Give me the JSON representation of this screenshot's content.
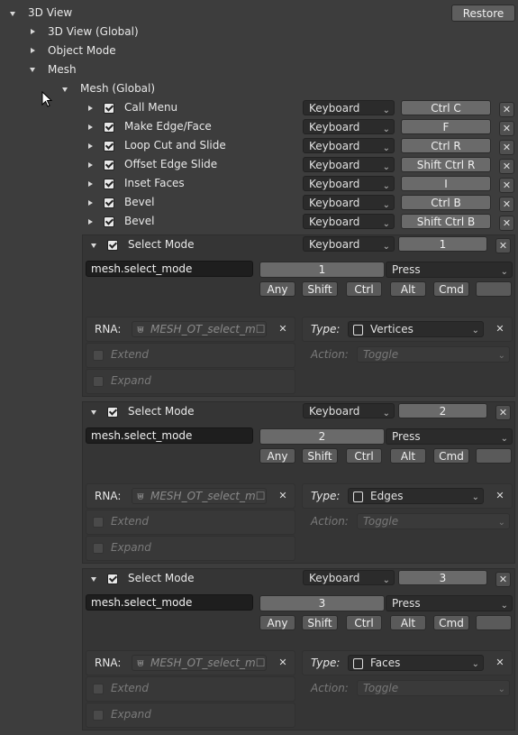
{
  "header": {
    "title": "3D View",
    "restore_label": "Restore"
  },
  "tree": {
    "global": "3D View (Global)",
    "object_mode": "Object Mode",
    "mesh": "Mesh",
    "mesh_global": "Mesh (Global)"
  },
  "keymap_items": [
    {
      "name": "Call Menu",
      "type": "Keyboard",
      "key": "Ctrl C"
    },
    {
      "name": "Make Edge/Face",
      "type": "Keyboard",
      "key": "F"
    },
    {
      "name": "Loop Cut and Slide",
      "type": "Keyboard",
      "key": "Ctrl R"
    },
    {
      "name": "Offset Edge Slide",
      "type": "Keyboard",
      "key": "Shift Ctrl R"
    },
    {
      "name": "Inset Faces",
      "type": "Keyboard",
      "key": "I"
    },
    {
      "name": "Bevel",
      "type": "Keyboard",
      "key": "Ctrl B"
    },
    {
      "name": "Bevel",
      "type": "Keyboard",
      "key": "Shift Ctrl B"
    }
  ],
  "expanded_items": [
    {
      "name": "Select Mode",
      "type": "Keyboard",
      "key": "1",
      "operator": "mesh.select_mode",
      "key_field": "1",
      "event": "Press",
      "modifiers": [
        "Any",
        "Shift",
        "Ctrl",
        "Alt",
        "Cmd"
      ],
      "rna_label": "RNA:",
      "rna_value": "MESH_OT_select_m☐",
      "type_label": "Type:",
      "type_value": "Vertices",
      "extend": "Extend",
      "expand": "Expand",
      "action_label": "Action:",
      "action_value": "Toggle"
    },
    {
      "name": "Select Mode",
      "type": "Keyboard",
      "key": "2",
      "operator": "mesh.select_mode",
      "key_field": "2",
      "event": "Press",
      "modifiers": [
        "Any",
        "Shift",
        "Ctrl",
        "Alt",
        "Cmd"
      ],
      "rna_label": "RNA:",
      "rna_value": "MESH_OT_select_m☐",
      "type_label": "Type:",
      "type_value": "Edges",
      "extend": "Extend",
      "expand": "Expand",
      "action_label": "Action:",
      "action_value": "Toggle"
    },
    {
      "name": "Select Mode",
      "type": "Keyboard",
      "key": "3",
      "operator": "mesh.select_mode",
      "key_field": "3",
      "event": "Press",
      "modifiers": [
        "Any",
        "Shift",
        "Ctrl",
        "Alt",
        "Cmd"
      ],
      "rna_label": "RNA:",
      "rna_value": "MESH_OT_select_m☐",
      "type_label": "Type:",
      "type_value": "Faces",
      "extend": "Extend",
      "expand": "Expand",
      "action_label": "Action:",
      "action_value": "Toggle"
    }
  ],
  "icons": {
    "remove": "✕",
    "collapse": "disclosure-down",
    "expand": "disclosure-right"
  },
  "colors": {
    "background": "#3d3d3d",
    "field": "#1e1e1e",
    "key_button": "#6a6a6a"
  }
}
